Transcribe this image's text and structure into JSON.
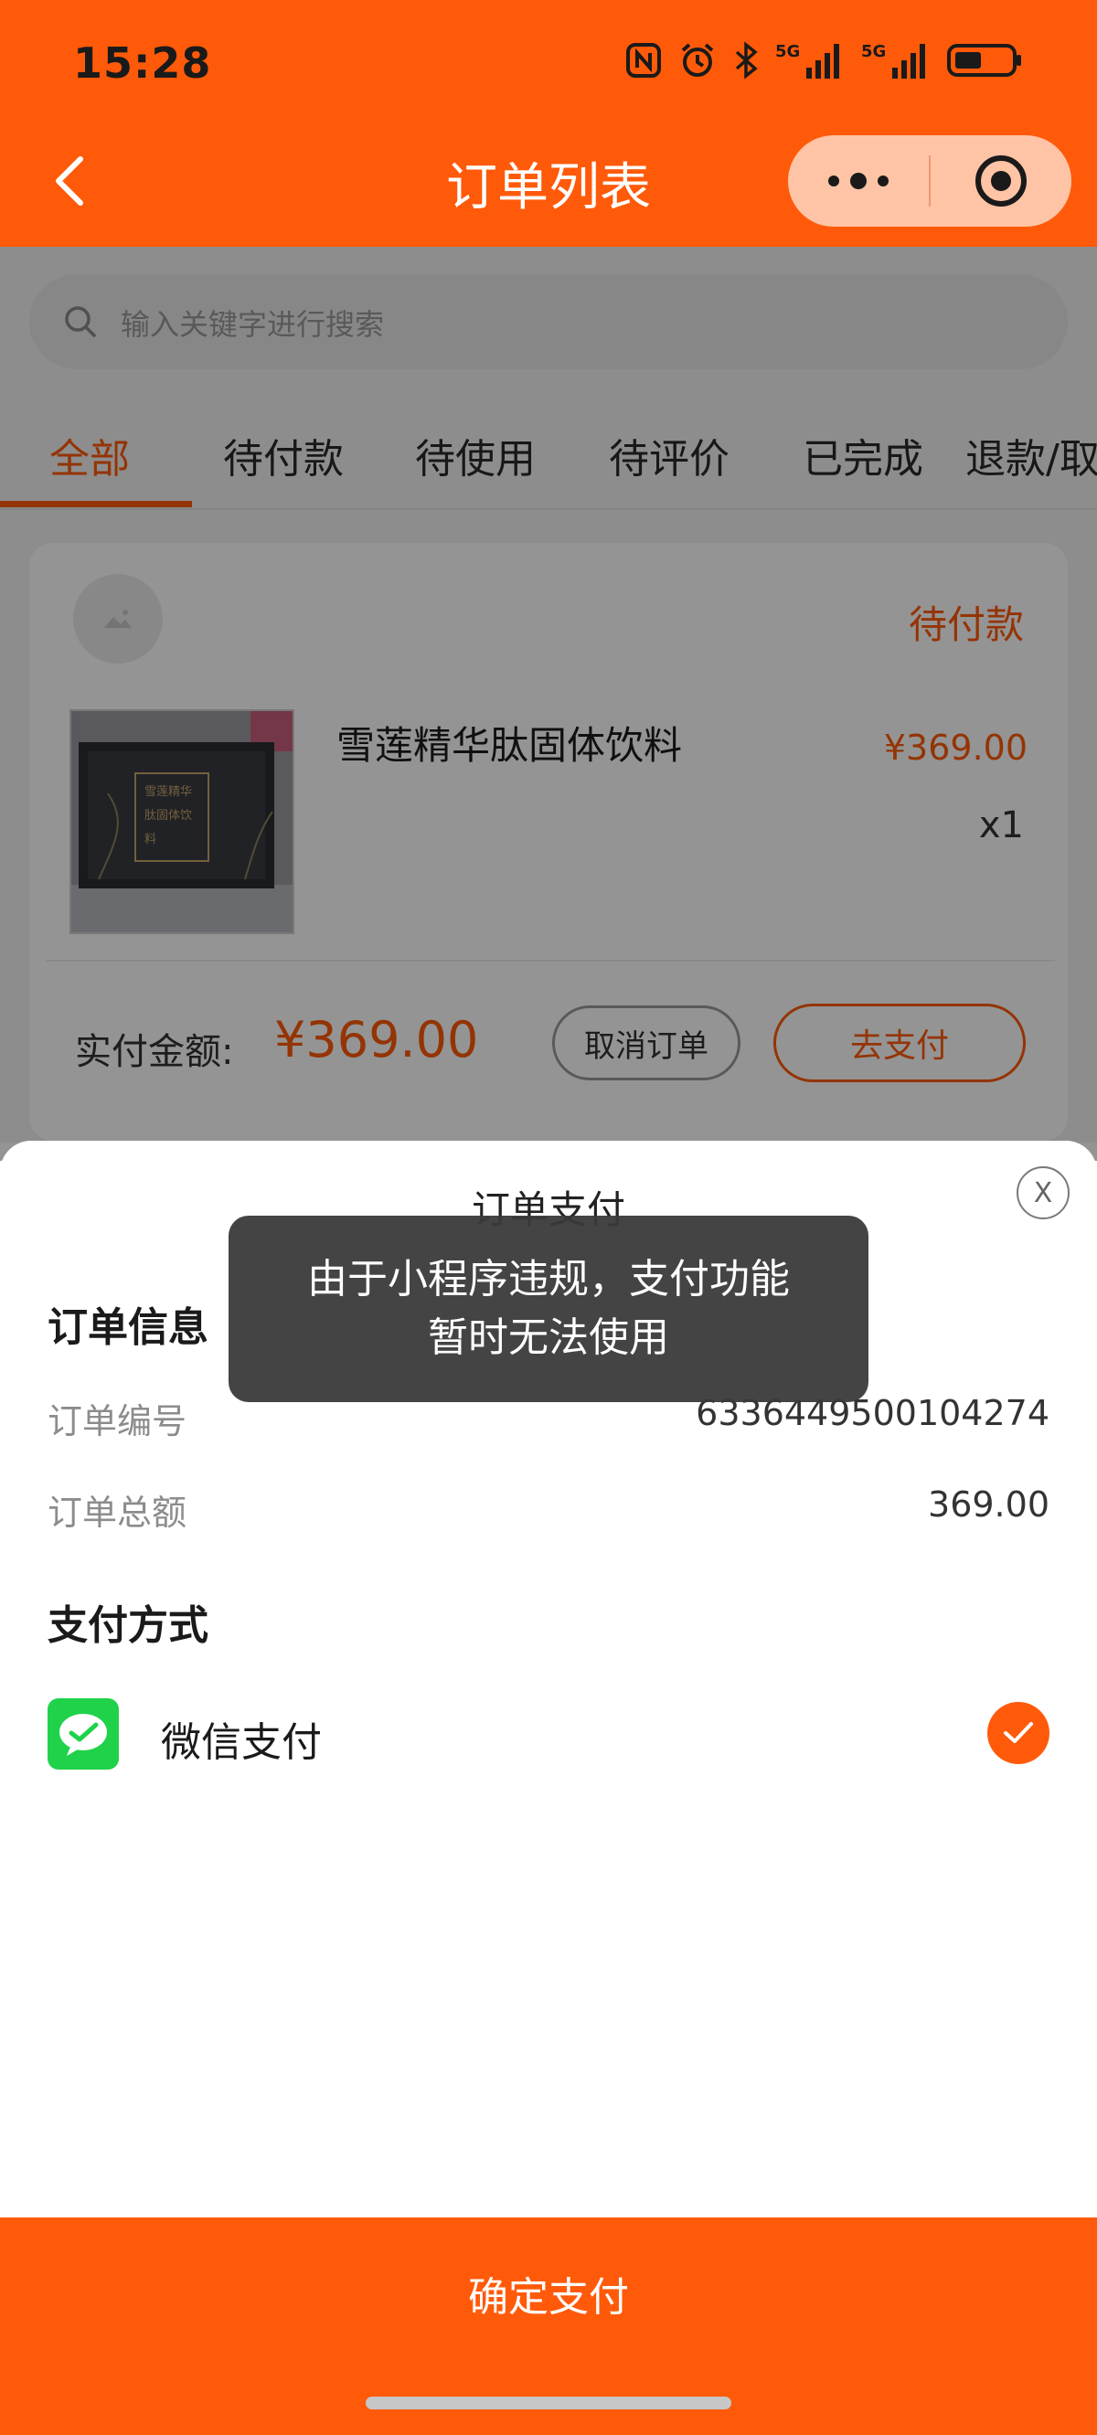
{
  "status_bar": {
    "time": "15:28"
  },
  "header": {
    "title": "订单列表"
  },
  "search": {
    "placeholder": "输入关键字进行搜索"
  },
  "tabs": [
    {
      "label": "全部",
      "active": true
    },
    {
      "label": "待付款"
    },
    {
      "label": "待使用"
    },
    {
      "label": "待评价"
    },
    {
      "label": "已完成"
    },
    {
      "label": "退款/取"
    }
  ],
  "order_card": {
    "status": "待付款",
    "product": {
      "name": "雪莲精华肽固体饮料",
      "price": "¥369.00",
      "qty": "x1",
      "box_text": "雪莲精华肽固体饮料"
    },
    "paid_label": "实付金额:",
    "paid_amount": "¥369.00",
    "cancel_label": "取消订单",
    "pay_label": "去支付"
  },
  "payment_sheet": {
    "title": "订单支付",
    "close_label": "X",
    "order_info_title": "订单信息",
    "order_no_label": "订单编号",
    "order_no_value": "6336449500104274",
    "order_total_label": "订单总额",
    "order_total_value": "369.00",
    "method_title": "支付方式",
    "method_label": "微信支付",
    "confirm_label": "确定支付"
  },
  "toast": {
    "line1": "由于小程序违规，支付功能",
    "line2": "暂时无法使用"
  },
  "colors": {
    "brand": "#ff5a0a",
    "wechat_green": "#1fd24a"
  },
  "icons": [
    "back-icon",
    "more-dots-icon",
    "target-icon",
    "search-icon",
    "nfc-icon",
    "alarm-icon",
    "bluetooth-icon",
    "signal-icon",
    "battery-icon",
    "close-icon",
    "wechat-icon",
    "checkmark-icon",
    "image-placeholder-icon"
  ]
}
